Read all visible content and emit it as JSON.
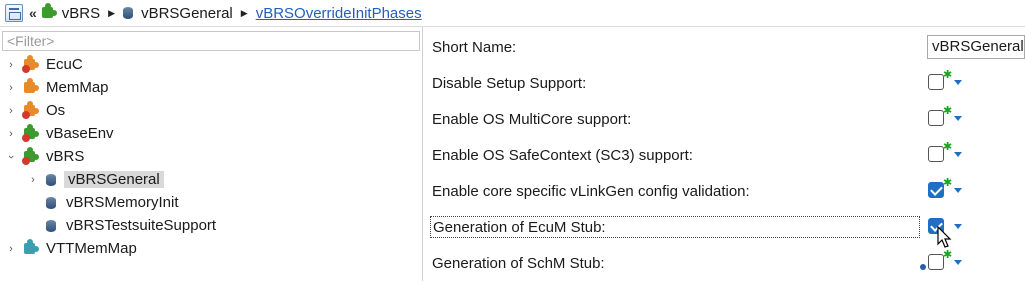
{
  "breadcrumb": {
    "items": [
      {
        "label": "vBRS",
        "link": false
      },
      {
        "label": "vBRSGeneral",
        "link": false
      },
      {
        "label": "vBRSOverrideInitPhases",
        "link": true
      }
    ]
  },
  "filter": {
    "placeholder": "<Filter>"
  },
  "tree": [
    {
      "label": "EcuC",
      "expanded": false,
      "icon": "puzzle-orange-icon"
    },
    {
      "label": "MemMap",
      "expanded": false,
      "icon": "puzzle-orange-icon"
    },
    {
      "label": "Os",
      "expanded": false,
      "icon": "puzzle-orange-icon"
    },
    {
      "label": "vBaseEnv",
      "expanded": false,
      "icon": "puzzle-green-icon"
    },
    {
      "label": "vBRS",
      "expanded": true,
      "icon": "puzzle-green-icon"
    },
    {
      "label": "vBRSGeneral",
      "selected": true,
      "icon": "container-icon"
    },
    {
      "label": "vBRSMemoryInit",
      "icon": "container-icon"
    },
    {
      "label": "vBRSTestsuiteSupport",
      "icon": "container-icon"
    },
    {
      "label": "VTTMemMap",
      "expanded": false,
      "icon": "puzzle-teal-icon"
    }
  ],
  "properties": {
    "short_name": {
      "label": "Short Name:",
      "value": "vBRSGeneral"
    },
    "disable_setup": {
      "label": "Disable Setup Support:",
      "checked": false
    },
    "os_multicore": {
      "label": "Enable OS MultiCore support:",
      "checked": false
    },
    "os_safecontext": {
      "label": "Enable OS SafeContext (SC3) support:",
      "checked": false
    },
    "core_specific_validation": {
      "label": "Enable core specific vLinkGen config validation:",
      "checked": true
    },
    "ecum_stub": {
      "label": "Generation of EcuM Stub:",
      "checked": true
    },
    "schm_stub": {
      "label": "Generation of SchM Stub:",
      "checked": false
    }
  },
  "colors": {
    "accent": "#1f6fc5",
    "link": "#1f5fbf",
    "star": "#19a319"
  }
}
